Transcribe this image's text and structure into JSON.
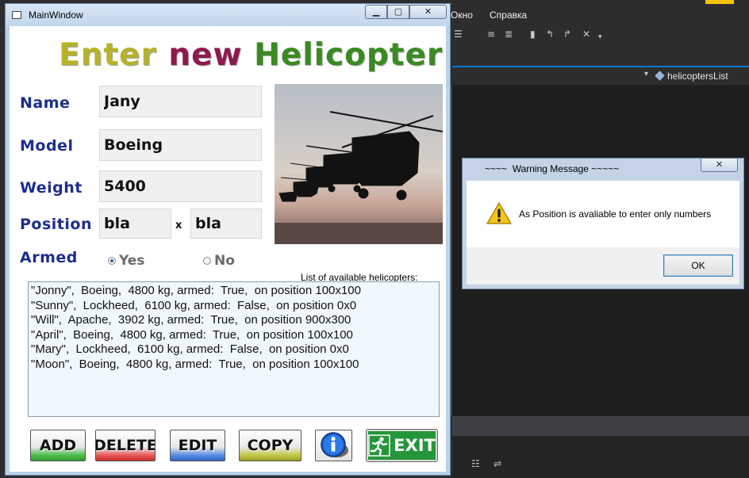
{
  "ide": {
    "menu": [
      "Окно",
      "Справка"
    ],
    "member_dropdown": "helicoptersList",
    "colors": {
      "background": "#2d2d30",
      "editor": "#1e1e1e",
      "accent": "#007acc"
    }
  },
  "main_window": {
    "title": "MainWindow",
    "heading": {
      "word1": "Enter",
      "word2": "new",
      "word3": "Helicopter"
    },
    "labels": {
      "name": "Name",
      "model": "Model",
      "weight": "Weight",
      "position": "Position",
      "armed": "Armed"
    },
    "fields": {
      "name": "Jany",
      "model": "Boeing",
      "weight": "5400",
      "position_x": "bla",
      "position_y": "bla"
    },
    "position_separator": "x",
    "armed_options": [
      {
        "label": "Yes",
        "selected": true
      },
      {
        "label": "No",
        "selected": false
      }
    ],
    "photo_icon": "helicopter-formation-photo",
    "list_caption": "List of available helicopters:",
    "helicopters": [
      "\"Jonny\",  Boeing,  4800 kg, armed:  True,  on position 100x100",
      "\"Sunny\",  Lockheed,  6100 kg, armed:  False,  on position 0x0",
      "\"Will\",  Apache,  3902 kg, armed:  True,  on position 900x300",
      "\"April\",  Boeing,  4800 kg, armed:  True,  on position 100x100",
      "\"Mary\",  Lockheed,  6100 kg, armed:  False,  on position 0x0",
      "\"Moon\",  Boeing,  4800 kg, armed:  True,  on position 100x100"
    ],
    "buttons": {
      "add": "ADD",
      "delete": "DELETE",
      "edit": "EDIT",
      "copy": "COPY",
      "exit": "EXIT"
    },
    "colors": {
      "heading1": "#b6b22c",
      "heading2": "#8e1a4e",
      "heading3": "#3b8a22",
      "labels": "#1d2d8e",
      "exit": "#25963b"
    }
  },
  "warning_dialog": {
    "title": "~~~~  Warning Message ~~~~~",
    "message": "As Position is avaliable to enter only numbers",
    "ok_label": "OK",
    "icon": "warning-icon"
  }
}
